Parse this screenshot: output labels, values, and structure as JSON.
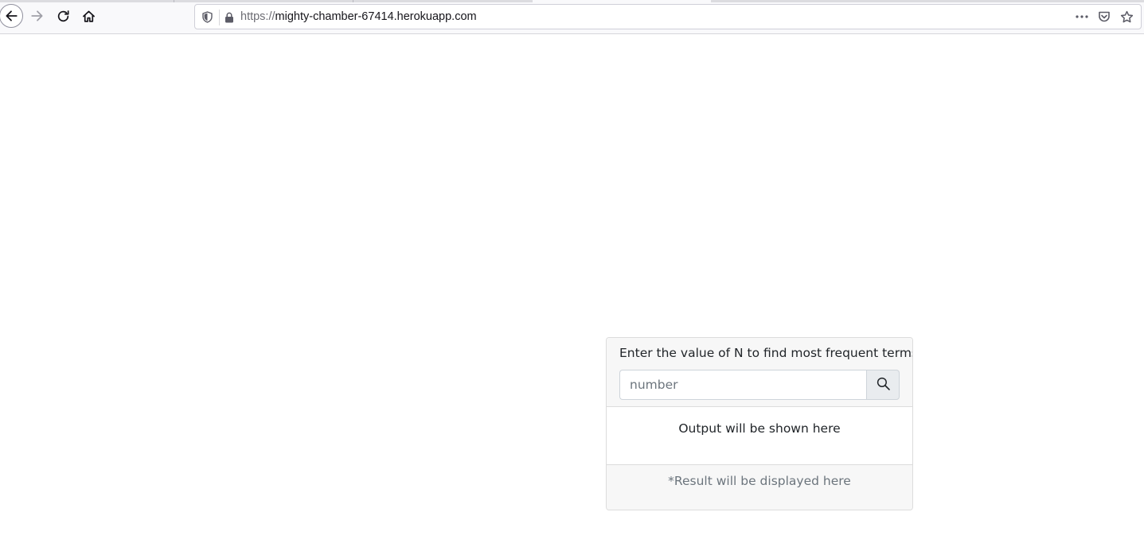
{
  "browser": {
    "url_scheme": "https://",
    "url_host": "mighty-chamber-67414.herokuapp.com",
    "nav_icons": [
      "back-icon",
      "forward-icon",
      "reload-icon",
      "home-icon"
    ],
    "url_icons": [
      "shield-icon",
      "lock-icon"
    ],
    "action_icons": [
      "more-icon",
      "pocket-icon",
      "star-icon"
    ]
  },
  "form": {
    "title": "Enter the value of N to find most frequent terms",
    "input_value": "",
    "input_placeholder": "number",
    "button_icon": "search-icon"
  },
  "output": {
    "text": "Output will be shown here"
  },
  "footer": {
    "text": "*Result will be displayed here"
  },
  "colors": {
    "card_header_bg": "#f7f7f7",
    "button_bg": "#e9ecef",
    "muted_text": "#6c757d"
  }
}
